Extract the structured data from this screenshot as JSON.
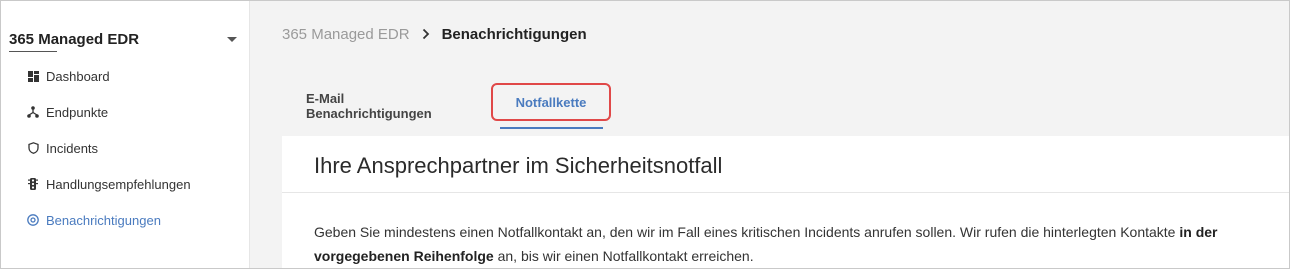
{
  "sidebar": {
    "product_title": "365 Managed EDR",
    "items": [
      {
        "label": "Dashboard",
        "icon": "dashboard-icon"
      },
      {
        "label": "Endpunkte",
        "icon": "network-icon"
      },
      {
        "label": "Incidents",
        "icon": "shield-icon"
      },
      {
        "label": "Handlungsempfehlungen",
        "icon": "traffic-light-icon"
      },
      {
        "label": "Benachrichtigungen",
        "icon": "at-sign-icon",
        "active": true
      }
    ]
  },
  "breadcrumb": {
    "root": "365 Managed EDR",
    "current": "Benachrichtigungen"
  },
  "tabs": {
    "email": "E-Mail Benachrichtigungen",
    "notfall": "Notfallkette",
    "active": "notfall"
  },
  "card": {
    "title": "Ihre Ansprechpartner im Sicherheitsnotfall",
    "text_part1": "Geben Sie mindestens einen Notfallkontakt an, den wir im Fall eines kritischen Incidents anrufen sollen. Wir rufen die hinterlegten Kontakte",
    "text_bold": "in der vorgegebenen Reihenfolge",
    "text_part2": " an, bis wir einen Notfallkontakt erreichen."
  },
  "colors": {
    "accent": "#4a7bbf",
    "highlight_border": "#e04848",
    "background": "#f3f3f3"
  }
}
